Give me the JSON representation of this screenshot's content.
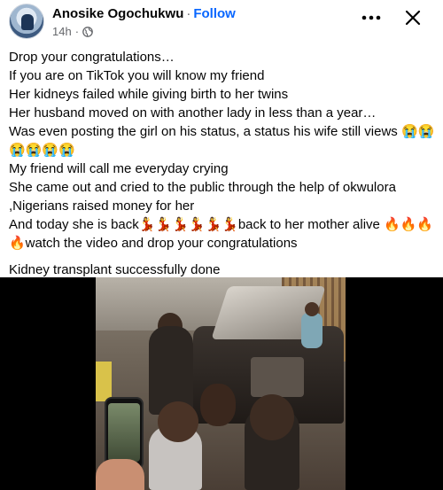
{
  "post": {
    "author": "Anosike Ogochukwu",
    "separator": "·",
    "follow_label": "Follow",
    "timestamp": "14h",
    "meta_dot": "·",
    "audience_icon": "globe-icon",
    "more_icon": "more-options-icon",
    "close_icon": "close-icon",
    "lines": [
      "Drop your congratulations…",
      "If you are on TikTok you will know my friend",
      "Her kidneys failed while giving birth to her twins",
      "Her husband moved on with another lady in less than a year…",
      "Was even posting the girl on his status, a status his wife still views 😭😭",
      "😭😭😭😭",
      "My friend will call me everyday crying",
      "She came out and cried to the public through the help of okwulora",
      ",Nigerians raised money for her",
      "And today she is back💃💃💃💃💃💃back to her mother alive 🔥🔥🔥",
      "🔥watch the video and drop your congratulations"
    ],
    "final_line": "Kidney transplant successfully done"
  },
  "colors": {
    "follow": "#0866ff",
    "secondary_text": "#65676b",
    "primary_text": "#050505",
    "video_background": "#000000"
  }
}
